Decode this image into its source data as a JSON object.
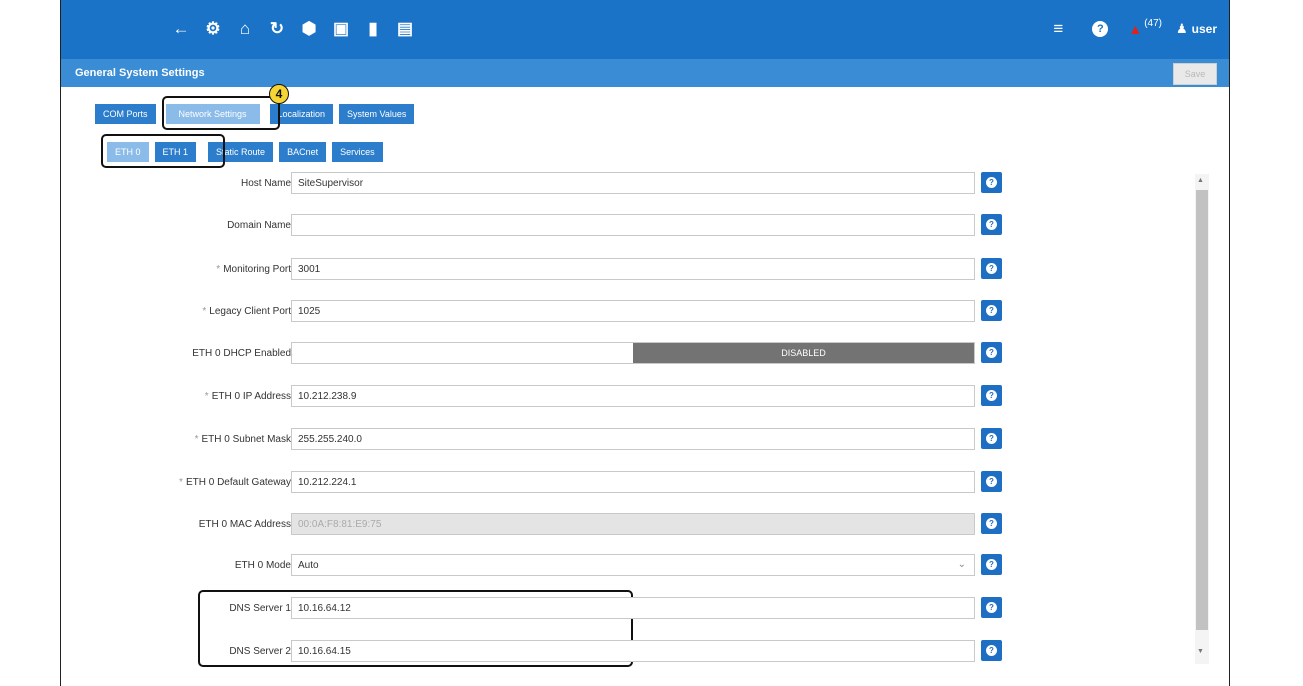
{
  "colors": {
    "topbar": "#1a73c6",
    "subbar": "#3a8cd4",
    "tab": "#2c7dcb",
    "tab_active": "#8bbbe8",
    "help": "#1e6fc4",
    "alarm": "#e0221b",
    "callout": "#f5d433"
  },
  "header": {
    "icons": [
      "back-arrow-icon",
      "gear-icon",
      "home-icon",
      "refresh-icon",
      "cube-icon",
      "calendar-icon",
      "map-icon",
      "dashboard-icon"
    ],
    "alarm_count": "(47)",
    "user": "user"
  },
  "subheader": {
    "title": "General System Settings",
    "save_label": "Save"
  },
  "tabs": [
    "COM Ports",
    "Network Settings",
    "Localization",
    "System Values"
  ],
  "subtabs": [
    "ETH 0",
    "ETH 1",
    "Static Route",
    "BACnet",
    "Services"
  ],
  "callout": "4",
  "form": {
    "host_name": {
      "label": "Host Name",
      "value": "SiteSupervisor"
    },
    "domain_name": {
      "label": "Domain Name",
      "value": ""
    },
    "monitoring_port": {
      "label": "Monitoring Port",
      "value": "3001"
    },
    "legacy_client_port": {
      "label": "Legacy Client Port",
      "value": "1025"
    },
    "dhcp": {
      "label": "ETH 0 DHCP Enabled",
      "state": "DISABLED"
    },
    "ip_address": {
      "label": "ETH 0 IP Address",
      "value": "10.212.238.9"
    },
    "subnet_mask": {
      "label": "ETH 0 Subnet Mask",
      "value": "255.255.240.0"
    },
    "default_gateway": {
      "label": "ETH 0 Default Gateway",
      "value": "10.212.224.1"
    },
    "mac_address": {
      "label": "ETH 0 MAC Address",
      "value": "00:0A:F8:81:E9:75"
    },
    "mode": {
      "label": "ETH 0 Mode",
      "value": "Auto"
    },
    "dns1": {
      "label": "DNS Server 1",
      "value": "10.16.64.12"
    },
    "dns2": {
      "label": "DNS Server 2",
      "value": "10.16.64.15"
    }
  }
}
